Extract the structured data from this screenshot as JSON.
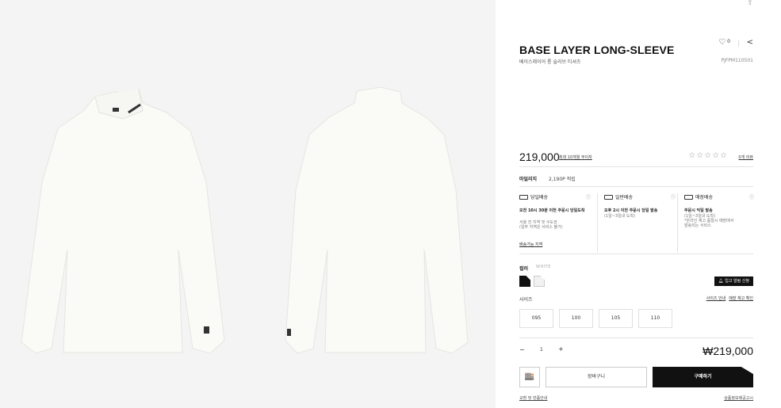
{
  "product": {
    "title": "BASE LAYER LONG-SLEEVE",
    "subtitle": "베이스레이어 롱 슬리브 티셔츠",
    "code": "PJFPM110501",
    "wish_count": "0",
    "price": "219,000",
    "installment": "최대 10개월 무이자",
    "stars": "☆☆☆☆☆",
    "review_link": "0개 리뷰"
  },
  "mileage": {
    "label": "마일리지",
    "value": "2,190P 적립"
  },
  "delivery": [
    {
      "name": "당일배송",
      "title": "오전 10시 30분 이전 주문시 당일도착",
      "desc": "서울 전 지역 및 수도권\n(일부 지역은 서비스 불가)"
    },
    {
      "name": "일반배송",
      "title": "오후 2시 이전 주문시 당일 발송",
      "desc": "(1일~3일내 도착)"
    },
    {
      "name": "매장배송",
      "title": "주문시 익일 발송",
      "desc": "(1일~3일내 도착)\n*온라인 재고 품절시 매장에서\n발송되는 서비스"
    }
  ],
  "delivery_area_link": "배송가능 지역",
  "options": {
    "color_label": "컬러",
    "color_value": "WHITE",
    "restock_label": "입고 알림 신청",
    "size_label": "사이즈",
    "size_guide": "사이즈 안내",
    "store_stock": "매장 재고 확인",
    "sizes": [
      "095",
      "100",
      "105",
      "110"
    ]
  },
  "quantity": {
    "minus": "−",
    "value": "1",
    "plus": "+"
  },
  "total": "₩219,000",
  "buttons": {
    "store_icon": "🏬",
    "cart": "장바구니",
    "buy": "구매하기"
  },
  "footer": {
    "left": "교환 및 반품안내",
    "right": "상품정보제공고시"
  },
  "icons": {
    "scroll_top": "⇧",
    "heart": "♡",
    "share": "<"
  }
}
